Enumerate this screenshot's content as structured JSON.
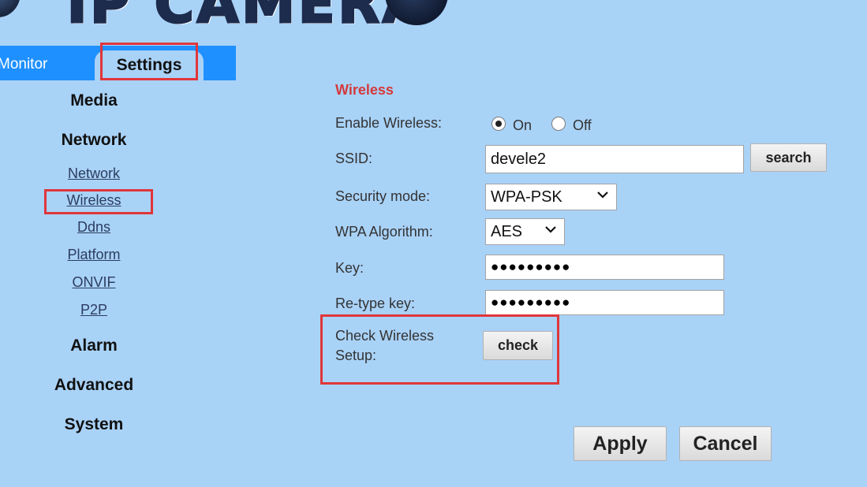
{
  "header": {
    "logo_text": "IP CAMERA"
  },
  "tabs": {
    "monitor": "Monitor",
    "settings": "Settings"
  },
  "sidebar": {
    "sections": {
      "media": "Media",
      "network": "Network",
      "alarm": "Alarm",
      "advanced": "Advanced",
      "system": "System"
    },
    "network_links": {
      "network": "Network",
      "wireless": "Wireless",
      "ddns": "Ddns",
      "platform": "Platform",
      "onvif": "ONVIF",
      "p2p": "P2P"
    }
  },
  "form": {
    "title": "Wireless",
    "enable_label": "Enable Wireless:",
    "enable_on": "On",
    "enable_off": "Off",
    "enable_value": "On",
    "ssid_label": "SSID:",
    "ssid_value": "devele2",
    "search_button": "search",
    "security_label": "Security mode:",
    "security_value": "WPA-PSK",
    "algorithm_label": "WPA Algorithm:",
    "algorithm_value": "AES",
    "key_label": "Key:",
    "key_value": "●●●●●●●●●",
    "retype_label": "Re-type key:",
    "retype_value": "●●●●●●●●●",
    "check_label_line1": "Check Wireless",
    "check_label_line2": "Setup:",
    "check_button": "check",
    "apply_button": "Apply",
    "cancel_button": "Cancel"
  },
  "colors": {
    "panel_bg": "#a9d2f7",
    "tab_bar": "#1e90ff",
    "section_title": "#d43a3a",
    "highlight_box": "#e0363a"
  }
}
